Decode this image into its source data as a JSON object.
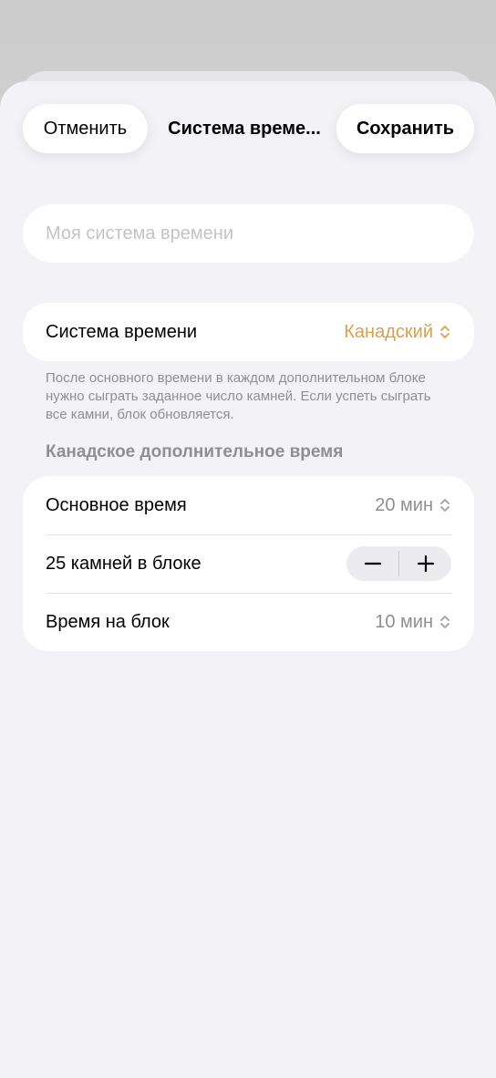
{
  "nav": {
    "cancel_label": "Отменить",
    "title": "Система време...",
    "save_label": "Сохранить"
  },
  "name_field": {
    "placeholder": "Моя система времени",
    "value": ""
  },
  "time_system": {
    "label": "Система времени",
    "value": "Канадский",
    "accent_color": "#d9a04b",
    "footnote": "После основного времени в каждом дополнительном блоке нужно сыграть заданное число камней. Если успеть сыграть все камни, блок обновляется."
  },
  "overtime": {
    "section_title": "Канадское дополнительное время",
    "main_time": {
      "label": "Основное время",
      "value": "20 мин"
    },
    "stones": {
      "label": "25 камней в блоке",
      "count": 25,
      "decrement_symbol": "−",
      "increment_symbol": "+"
    },
    "block_time": {
      "label": "Время на блок",
      "value": "10 мин"
    }
  },
  "icons": {
    "picker": "chevron-up-down-icon",
    "minus": "minus-icon",
    "plus": "plus-icon"
  }
}
